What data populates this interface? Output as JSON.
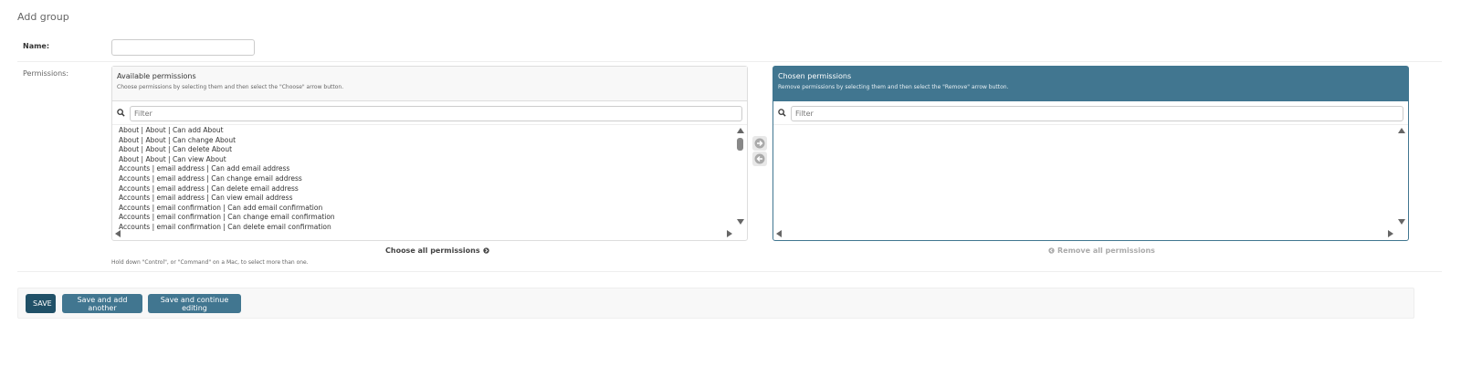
{
  "page": {
    "title": "Add group"
  },
  "form": {
    "name_label": "Name:",
    "name_value": "",
    "permissions_label": "Permissions:"
  },
  "available": {
    "title": "Available permissions",
    "help": "Choose permissions by selecting them and then select the \"Choose\" arrow button.",
    "filter_placeholder": "Filter",
    "options": [
      "About | About | Can add About",
      "About | About | Can change About",
      "About | About | Can delete About",
      "About | About | Can view About",
      "Accounts | email address | Can add email address",
      "Accounts | email address | Can change email address",
      "Accounts | email address | Can delete email address",
      "Accounts | email address | Can view email address",
      "Accounts | email confirmation | Can add email confirmation",
      "Accounts | email confirmation | Can change email confirmation",
      "Accounts | email confirmation | Can delete email confirmation"
    ],
    "choose_all_label": "Choose all permissions"
  },
  "chosen": {
    "title": "Chosen permissions",
    "help": "Remove permissions by selecting them and then select the \"Remove\" arrow button.",
    "filter_placeholder": "Filter",
    "options": [],
    "remove_all_label": "Remove all permissions"
  },
  "help_text": "Hold down \"Control\", or \"Command\" on a Mac, to select more than one.",
  "buttons": {
    "save": "SAVE",
    "save_add_another": "Save and add another",
    "save_continue": "Save and continue editing"
  },
  "colors": {
    "header_blue": "#417690",
    "save_dark": "#205067"
  }
}
